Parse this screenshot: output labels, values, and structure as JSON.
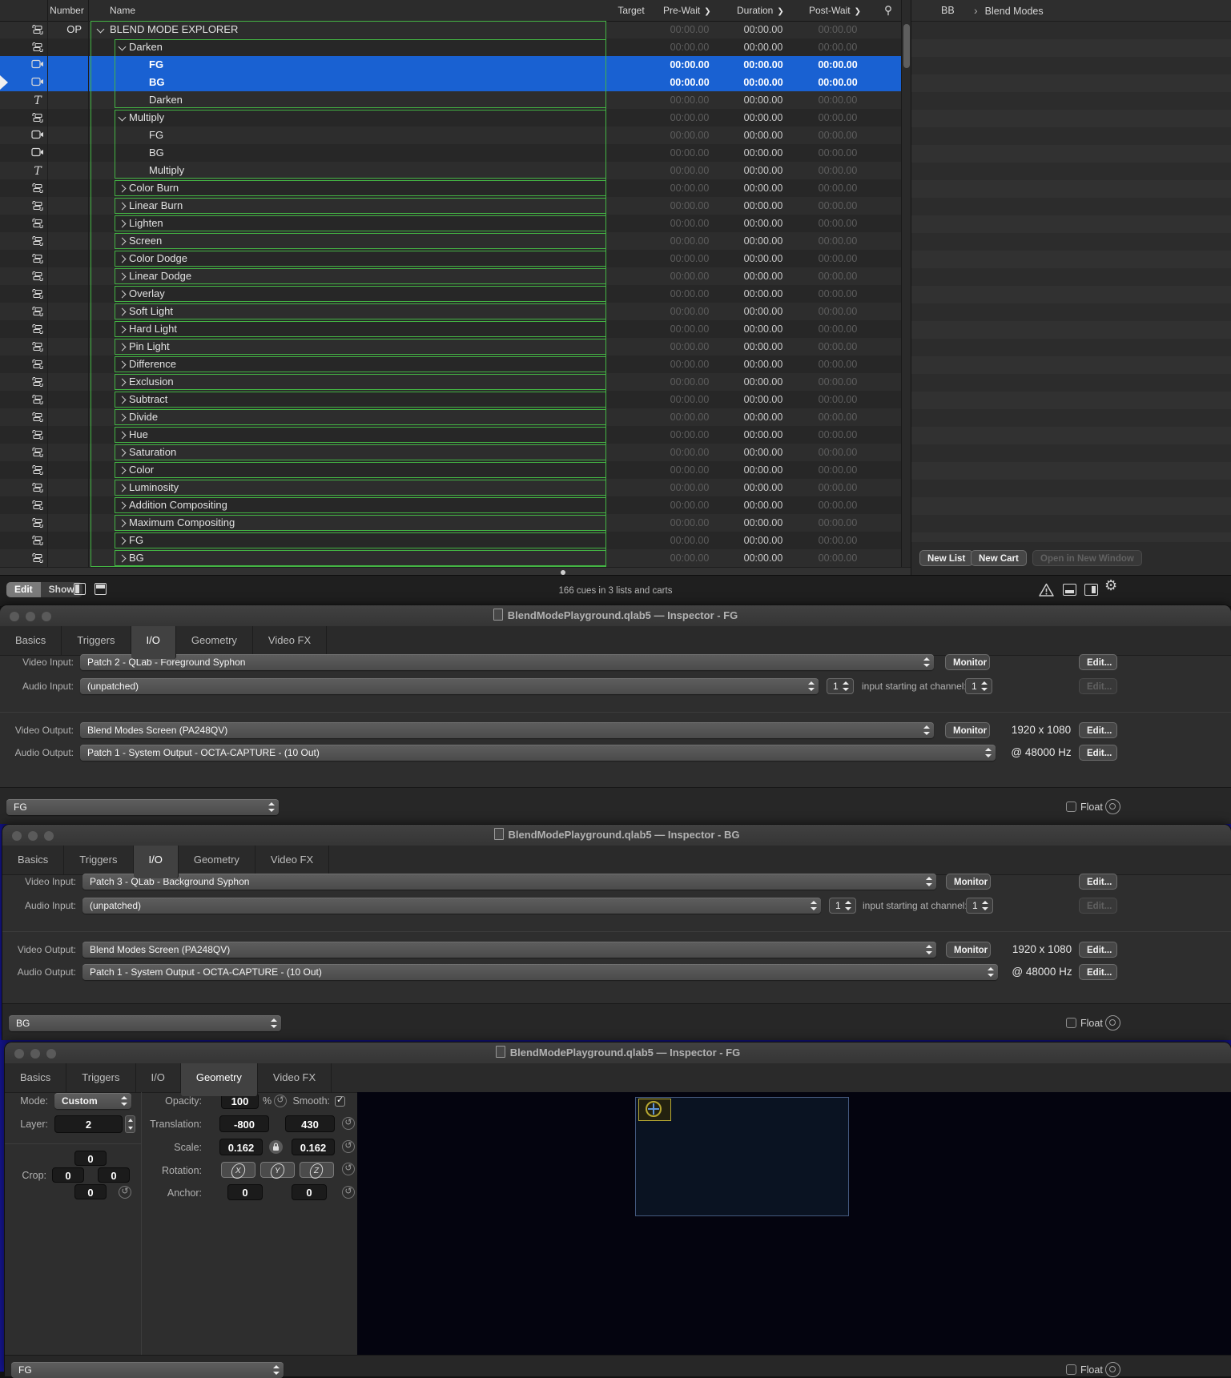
{
  "cue_list": {
    "columns": {
      "number": "Number",
      "name": "Name",
      "target": "Target",
      "pre_wait": "Pre-Wait",
      "duration": "Duration",
      "post_wait": "Post-Wait"
    },
    "time_value": "00:00.00",
    "rows": [
      {
        "type": "group-cue",
        "icon": "group",
        "number": "OP",
        "name": "BLEND MODE EXPLORER",
        "level": 0,
        "disclosure": "open",
        "span": 31
      },
      {
        "type": "group-cue",
        "icon": "group",
        "name": "Darken",
        "level": 1,
        "disclosure": "open",
        "span": 4
      },
      {
        "type": "video-cue",
        "icon": "video",
        "name": "FG",
        "level": 2,
        "selected": true
      },
      {
        "type": "video-cue",
        "icon": "video",
        "name": "BG",
        "level": 2,
        "selected": true,
        "playhead": true
      },
      {
        "type": "text-cue",
        "icon": "text",
        "name": "Darken",
        "level": 2
      },
      {
        "type": "group-cue",
        "icon": "group",
        "name": "Multiply",
        "level": 1,
        "disclosure": "open",
        "span": 4
      },
      {
        "type": "video-cue",
        "icon": "video",
        "name": "FG",
        "level": 2
      },
      {
        "type": "video-cue",
        "icon": "video",
        "name": "BG",
        "level": 2
      },
      {
        "type": "text-cue",
        "icon": "text",
        "name": "Multiply",
        "level": 2
      },
      {
        "type": "group-cue",
        "icon": "group",
        "name": "Color Burn",
        "level": 1,
        "disclosure": "closed",
        "span": 1
      },
      {
        "type": "group-cue",
        "icon": "group",
        "name": "Linear Burn",
        "level": 1,
        "disclosure": "closed",
        "span": 1
      },
      {
        "type": "group-cue",
        "icon": "group",
        "name": "Lighten",
        "level": 1,
        "disclosure": "closed",
        "span": 1
      },
      {
        "type": "group-cue",
        "icon": "group",
        "name": "Screen",
        "level": 1,
        "disclosure": "closed",
        "span": 1
      },
      {
        "type": "group-cue",
        "icon": "group",
        "name": "Color Dodge",
        "level": 1,
        "disclosure": "closed",
        "span": 1
      },
      {
        "type": "group-cue",
        "icon": "group",
        "name": "Linear Dodge",
        "level": 1,
        "disclosure": "closed",
        "span": 1
      },
      {
        "type": "group-cue",
        "icon": "group",
        "name": "Overlay",
        "level": 1,
        "disclosure": "closed",
        "span": 1
      },
      {
        "type": "group-cue",
        "icon": "group",
        "name": "Soft Light",
        "level": 1,
        "disclosure": "closed",
        "span": 1
      },
      {
        "type": "group-cue",
        "icon": "group",
        "name": "Hard Light",
        "level": 1,
        "disclosure": "closed",
        "span": 1
      },
      {
        "type": "group-cue",
        "icon": "group",
        "name": "Pin Light",
        "level": 1,
        "disclosure": "closed",
        "span": 1
      },
      {
        "type": "group-cue",
        "icon": "group",
        "name": "Difference",
        "level": 1,
        "disclosure": "closed",
        "span": 1
      },
      {
        "type": "group-cue",
        "icon": "group",
        "name": "Exclusion",
        "level": 1,
        "disclosure": "closed",
        "span": 1
      },
      {
        "type": "group-cue",
        "icon": "group",
        "name": "Subtract",
        "level": 1,
        "disclosure": "closed",
        "span": 1
      },
      {
        "type": "group-cue",
        "icon": "group",
        "name": "Divide",
        "level": 1,
        "disclosure": "closed",
        "span": 1
      },
      {
        "type": "group-cue",
        "icon": "group",
        "name": "Hue",
        "level": 1,
        "disclosure": "closed",
        "span": 1
      },
      {
        "type": "group-cue",
        "icon": "group",
        "name": "Saturation",
        "level": 1,
        "disclosure": "closed",
        "span": 1
      },
      {
        "type": "group-cue",
        "icon": "group",
        "name": "Color",
        "level": 1,
        "disclosure": "closed",
        "span": 1
      },
      {
        "type": "group-cue",
        "icon": "group",
        "name": "Luminosity",
        "level": 1,
        "disclosure": "closed",
        "span": 1
      },
      {
        "type": "group-cue",
        "icon": "group",
        "name": "Addition Compositing",
        "level": 1,
        "disclosure": "closed",
        "span": 1
      },
      {
        "type": "group-cue",
        "icon": "group",
        "name": "Maximum Compositing",
        "level": 1,
        "disclosure": "closed",
        "span": 1
      },
      {
        "type": "group-cue",
        "icon": "group",
        "name": "FG",
        "level": 1,
        "disclosure": "closed",
        "span": 1
      },
      {
        "type": "group-cue",
        "icon": "group",
        "name": "BG",
        "level": 1,
        "disclosure": "closed",
        "span": 1
      }
    ]
  },
  "right_panel": {
    "list_tab": "BB",
    "breadcrumb": "Blend Modes",
    "new_list_button": "New List",
    "new_cart_button": "New Cart",
    "open_new_window_button": "Open in New Window"
  },
  "status_bar": {
    "edit": "Edit",
    "show": "Show",
    "summary": "166 cues in 3 lists and carts"
  },
  "inspector_fg": {
    "title": "BlendModePlayground.qlab5 — Inspector - FG",
    "tabs": [
      "Basics",
      "Triggers",
      "I/O",
      "Geometry",
      "Video FX"
    ],
    "selected_tab": "I/O",
    "labels": {
      "video_input": "Video Input:",
      "audio_input": "Audio Input:",
      "video_output": "Video Output:",
      "audio_output": "Audio Output:",
      "channel": "input starting at channel:"
    },
    "video_input": "Patch 2 - QLab - Foreground Syphon",
    "audio_input": "(unpatched)",
    "channel_count": "1",
    "channel_start": "1",
    "video_output": "Blend Modes Screen (PA248QV)",
    "resolution": "1920 x 1080",
    "audio_output": "Patch 1 - System Output - OCTA-CAPTURE - (10 Out)",
    "sample_rate": "@ 48000 Hz",
    "monitor_button": "Monitor",
    "edit_button": "Edit...",
    "cue_selector": "FG",
    "float_label": "Float"
  },
  "inspector_bg": {
    "title": "BlendModePlayground.qlab5 — Inspector - BG",
    "tabs": [
      "Basics",
      "Triggers",
      "I/O",
      "Geometry",
      "Video FX"
    ],
    "selected_tab": "I/O",
    "labels": {
      "video_input": "Video Input:",
      "audio_input": "Audio Input:",
      "video_output": "Video Output:",
      "audio_output": "Audio Output:",
      "channel": "input starting at channel:"
    },
    "video_input": "Patch 3 - QLab - Background Syphon",
    "audio_input": "(unpatched)",
    "channel_count": "1",
    "channel_start": "1",
    "video_output": "Blend Modes Screen (PA248QV)",
    "resolution": "1920 x 1080",
    "audio_output": "Patch 1 - System Output - OCTA-CAPTURE - (10 Out)",
    "sample_rate": "@ 48000 Hz",
    "monitor_button": "Monitor",
    "edit_button": "Edit...",
    "cue_selector": "BG",
    "float_label": "Float"
  },
  "inspector_geometry": {
    "title": "BlendModePlayground.qlab5 — Inspector - FG",
    "tabs": [
      "Basics",
      "Triggers",
      "I/O",
      "Geometry",
      "Video FX"
    ],
    "selected_tab": "Geometry",
    "mode_label": "Mode:",
    "mode": "Custom",
    "layer_label": "Layer:",
    "layer": "2",
    "crop_label": "Crop:",
    "crop_top": "0",
    "crop_left": "0",
    "crop_right": "0",
    "crop_bottom": "0",
    "opacity_label": "Opacity:",
    "opacity": "100",
    "percent": "%",
    "smooth_label": "Smooth:",
    "smooth_checked": true,
    "translation_label": "Translation:",
    "translation_x": "-800",
    "translation_y": "430",
    "scale_label": "Scale:",
    "scale_x": "0.162",
    "scale_y": "0.162",
    "rotation_label": "Rotation:",
    "rotation_x": "X",
    "rotation_y": "Y",
    "rotation_z": "Z",
    "anchor_label": "Anchor:",
    "anchor_x": "0",
    "anchor_y": "0",
    "cue_selector": "FG",
    "float_label": "Float"
  },
  "colors": {
    "selection_blue": "#1961d2",
    "group_green": "#44b544",
    "thumb_yellow": "#b7a832",
    "stage_border": "#44597f"
  }
}
